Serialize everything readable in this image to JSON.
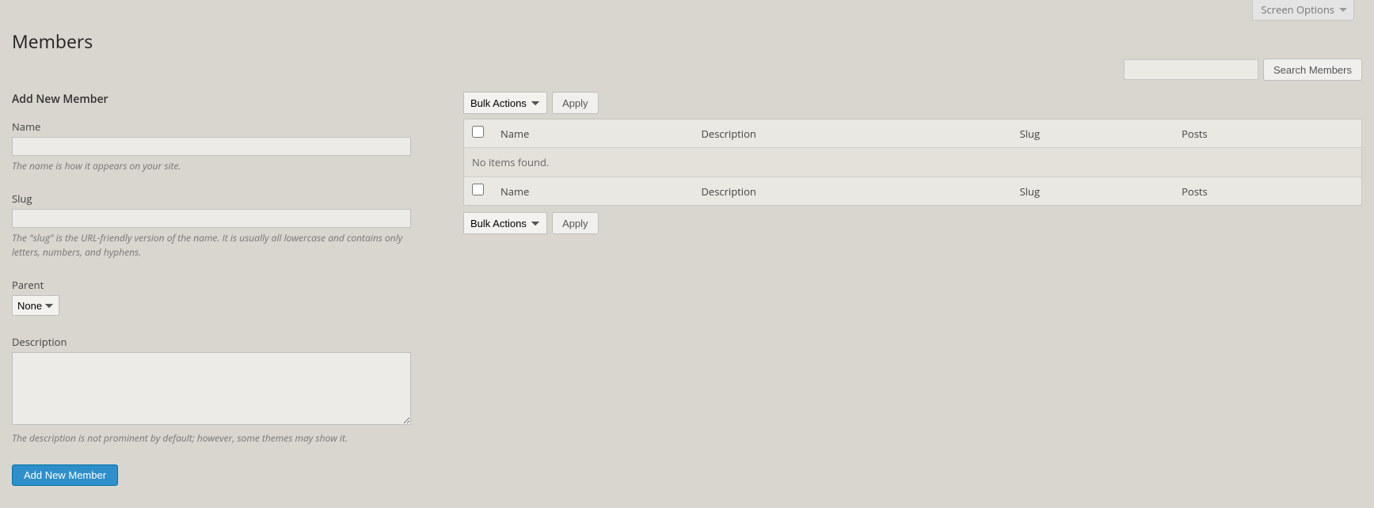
{
  "screen_options": {
    "label": "Screen Options"
  },
  "page": {
    "title": "Members"
  },
  "search": {
    "button": "Search Members"
  },
  "form": {
    "heading": "Add New Member",
    "name": {
      "label": "Name",
      "desc": "The name is how it appears on your site."
    },
    "slug": {
      "label": "Slug",
      "desc": "The \"slug\" is the URL-friendly version of the name. It is usually all lowercase and contains only letters, numbers, and hyphens."
    },
    "parent": {
      "label": "Parent",
      "option_none": "None"
    },
    "description": {
      "label": "Description",
      "desc": "The description is not prominent by default; however, some themes may show it."
    },
    "submit": "Add New Member"
  },
  "bulk": {
    "label": "Bulk Actions",
    "apply": "Apply"
  },
  "table": {
    "cols": {
      "name": "Name",
      "description": "Description",
      "slug": "Slug",
      "posts": "Posts"
    },
    "empty": "No items found."
  }
}
